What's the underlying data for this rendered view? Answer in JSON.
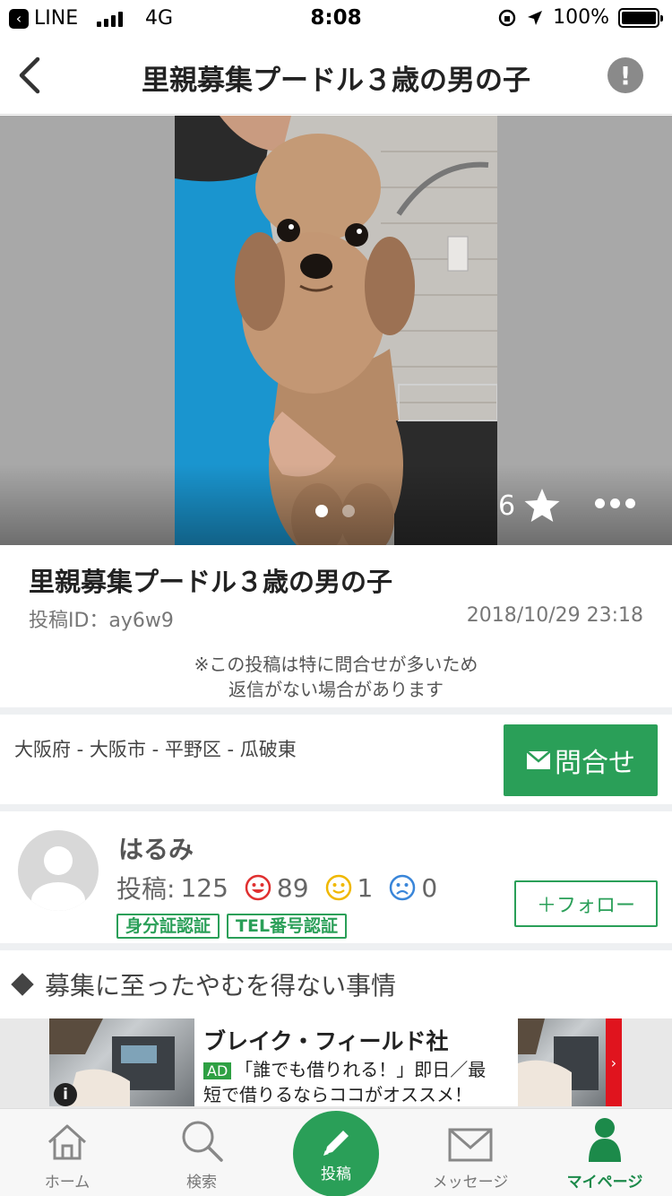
{
  "status": {
    "back_app": "LINE",
    "network": "4G",
    "time": "8:08",
    "battery": "100%"
  },
  "nav": {
    "title": "里親募集プードル３歳の男の子"
  },
  "photo": {
    "favorite_count": "6",
    "page_count": 2,
    "current_page": 1
  },
  "post": {
    "title": "里親募集プードル３歳の男の子",
    "id_label": "投稿ID：ay6w9",
    "date": "2018/10/29 23:18",
    "notice_line1": "※この投稿は特に問合せが多いため",
    "notice_line2": "返信がない場合があります"
  },
  "location": {
    "text": "大阪府 - 大阪市 - 平野区 - 瓜破東",
    "contact_label": "問合せ"
  },
  "user": {
    "name": "はるみ",
    "posts_label": "投稿:",
    "posts_count": "125",
    "good_count": "89",
    "normal_count": "1",
    "bad_count": "0",
    "badges": [
      "身分証認証",
      "TEL番号認証"
    ],
    "follow_label": "＋フォロー"
  },
  "section": {
    "title": "募集に至ったやむを得ない事情"
  },
  "ad": {
    "title": "ブレイク・フィールド社",
    "tag": "AD",
    "text_line1": "「誰でも借りれる！」即日／最",
    "text_line2": "短で借りるならココがオススメ！"
  },
  "tabs": {
    "home": "ホーム",
    "search": "検索",
    "post": "投稿",
    "message": "メッセージ",
    "mypage": "マイページ"
  },
  "colors": {
    "accent": "#2a9f58",
    "face_good": "#e03030",
    "face_normal": "#f0b800",
    "face_bad": "#3a86d9"
  }
}
